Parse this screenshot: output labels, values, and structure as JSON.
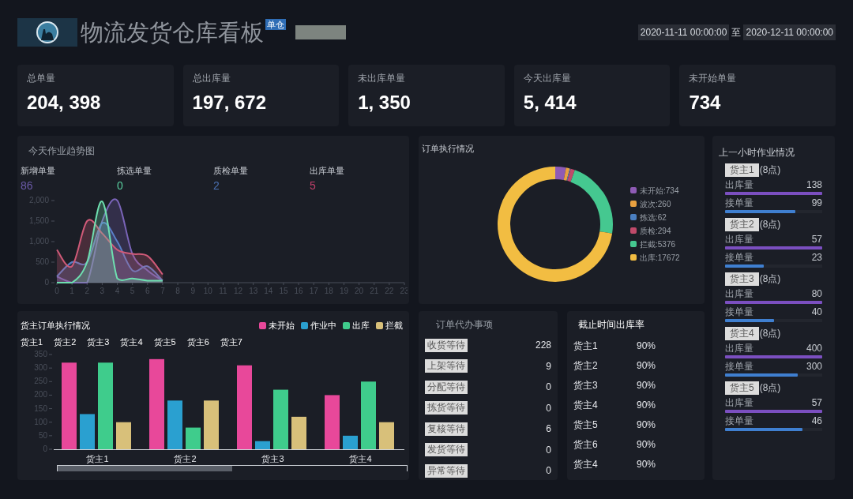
{
  "header": {
    "title": "物流发货仓库看板",
    "badge": "单仓",
    "date_from": "2020-11-11 00:00:00",
    "date_sep": "至",
    "date_to": "2020-12-11 00:00:00"
  },
  "kpis": [
    {
      "label": "总单量",
      "value": "204, 398"
    },
    {
      "label": "总出库量",
      "value": "197, 672"
    },
    {
      "label": "未出库单量",
      "value": "1, 350"
    },
    {
      "label": "今天出库量",
      "value": "5, 414"
    },
    {
      "label": "未开始单量",
      "value": "734"
    }
  ],
  "trend": {
    "title": "今天作业趋势图",
    "stats": [
      {
        "label": "新增单量",
        "value": "86",
        "color": "#6b5aa8"
      },
      {
        "label": "拣选单量",
        "value": "0",
        "color": "#5ad0a0"
      },
      {
        "label": "质检单量",
        "value": "2",
        "color": "#4a6fb0"
      },
      {
        "label": "出库单量",
        "value": "5",
        "color": "#c0406a"
      }
    ],
    "chart_data": {
      "type": "area",
      "x": [
        0,
        1,
        2,
        3,
        4,
        5,
        6,
        7
      ],
      "xlim": [
        0,
        23
      ],
      "xticks": [
        0,
        1,
        2,
        3,
        4,
        5,
        6,
        7,
        8,
        9,
        10,
        11,
        12,
        13,
        14,
        15,
        16,
        17,
        18,
        19,
        20,
        21,
        22,
        23
      ],
      "yticks": [
        {
          "value": 0,
          "label": "0"
        },
        {
          "value": 500,
          "label": "500"
        },
        {
          "value": 1000,
          "label": "1,000"
        },
        {
          "value": 1500,
          "label": "1,500"
        },
        {
          "value": 2000,
          "label": "2,000"
        }
      ],
      "ylim": [
        0,
        2000
      ],
      "series": [
        {
          "color": "#7a64b8",
          "values": [
            150,
            0,
            0,
            1500,
            2000,
            700,
            300,
            50
          ]
        },
        {
          "color": "#5a7fc8",
          "values": [
            150,
            500,
            500,
            1450,
            1000,
            300,
            400,
            50
          ]
        },
        {
          "color": "#d05a78",
          "values": [
            800,
            400,
            1500,
            1200,
            800,
            700,
            650,
            200
          ]
        },
        {
          "color": "#6ee0b0",
          "values": [
            0,
            0,
            500,
            1980,
            100,
            100,
            50,
            50
          ]
        }
      ]
    }
  },
  "orders": {
    "title": "订单执行情况",
    "chart_data": {
      "type": "donut",
      "categories": [
        "未开始:734",
        "波次:260",
        "拣选:62",
        "质检:294",
        "拦截:5376",
        "出库:17672"
      ],
      "values": [
        734,
        260,
        62,
        294,
        5376,
        17672
      ],
      "colors": [
        "#8e5bb5",
        "#e8a040",
        "#4a7fc1",
        "#c04a6a",
        "#45c890",
        "#f2bd42"
      ]
    }
  },
  "last_hour": {
    "title": "上一小时作业情况",
    "groups": [
      {
        "owner": "货主1",
        "time": "(8点)",
        "metrics": [
          {
            "kind": "out",
            "label": "出库量",
            "value": "138",
            "level": 1
          },
          {
            "kind": "in",
            "label": "接单量",
            "value": "99",
            "level": 0.72
          }
        ]
      },
      {
        "owner": "货主2",
        "time": "(8点)",
        "metrics": [
          {
            "kind": "out",
            "label": "出库量",
            "value": "57",
            "level": 1
          },
          {
            "kind": "in",
            "label": "接单量",
            "value": "23",
            "level": 0.4
          }
        ]
      },
      {
        "owner": "货主3",
        "time": "(8点)",
        "metrics": [
          {
            "kind": "out",
            "label": "出库量",
            "value": "80",
            "level": 1
          },
          {
            "kind": "in",
            "label": "接单量",
            "value": "40",
            "level": 0.5
          }
        ]
      },
      {
        "owner": "货主4",
        "time": "(8点)",
        "metrics": [
          {
            "kind": "out",
            "label": "出库量",
            "value": "400",
            "level": 1
          },
          {
            "kind": "in",
            "label": "接单量",
            "value": "300",
            "level": 0.75
          }
        ]
      },
      {
        "owner": "货主5",
        "time": "(8点)",
        "metrics": [
          {
            "kind": "out",
            "label": "出库量",
            "value": "57",
            "level": 1
          },
          {
            "kind": "in",
            "label": "接单量",
            "value": "46",
            "level": 0.8
          }
        ]
      }
    ]
  },
  "owner_orders": {
    "title": "货主订单执行情况",
    "owners": [
      "货主1",
      "货主2",
      "货主3",
      "货主4",
      "货主5",
      "货主6",
      "货主7"
    ],
    "chart_data": {
      "type": "bar",
      "categories": [
        "货主1",
        "货主2",
        "货主3",
        "货主4"
      ],
      "yticks": [
        0,
        50,
        100,
        150,
        200,
        250,
        300,
        350
      ],
      "ylim": [
        0,
        350
      ],
      "series": [
        {
          "name": "未开始",
          "color": "#e8489a",
          "values": [
            320,
            333,
            310,
            200
          ]
        },
        {
          "name": "作业中",
          "color": "#2aa0d0",
          "values": [
            130,
            180,
            30,
            50
          ]
        },
        {
          "name": "出库",
          "color": "#3fcc8c",
          "values": [
            320,
            80,
            220,
            250
          ]
        },
        {
          "name": "拦截",
          "color": "#d8c07a",
          "values": [
            100,
            180,
            120,
            100
          ]
        }
      ]
    },
    "zoom": {
      "level": 0.5
    }
  },
  "todo": {
    "title": "订单代办事项",
    "items": [
      {
        "label": "收货等待",
        "value": "228"
      },
      {
        "label": "上架等待",
        "value": "9"
      },
      {
        "label": "分配等待",
        "value": "0"
      },
      {
        "label": "拣货等待",
        "value": "0"
      },
      {
        "label": "复核等待",
        "value": "6"
      },
      {
        "label": "发货等待",
        "value": "0"
      },
      {
        "label": "异常等待",
        "value": "0"
      }
    ]
  },
  "rates": {
    "title": "截止时间出库率",
    "rows": [
      {
        "owner": "货主1",
        "rate": "90%"
      },
      {
        "owner": "货主2",
        "rate": "90%"
      },
      {
        "owner": "货主3",
        "rate": "90%"
      },
      {
        "owner": "货主4",
        "rate": "90%"
      },
      {
        "owner": "货主5",
        "rate": "90%"
      },
      {
        "owner": "货主6",
        "rate": "90%"
      },
      {
        "owner": "货主4",
        "rate": "90%"
      }
    ]
  }
}
